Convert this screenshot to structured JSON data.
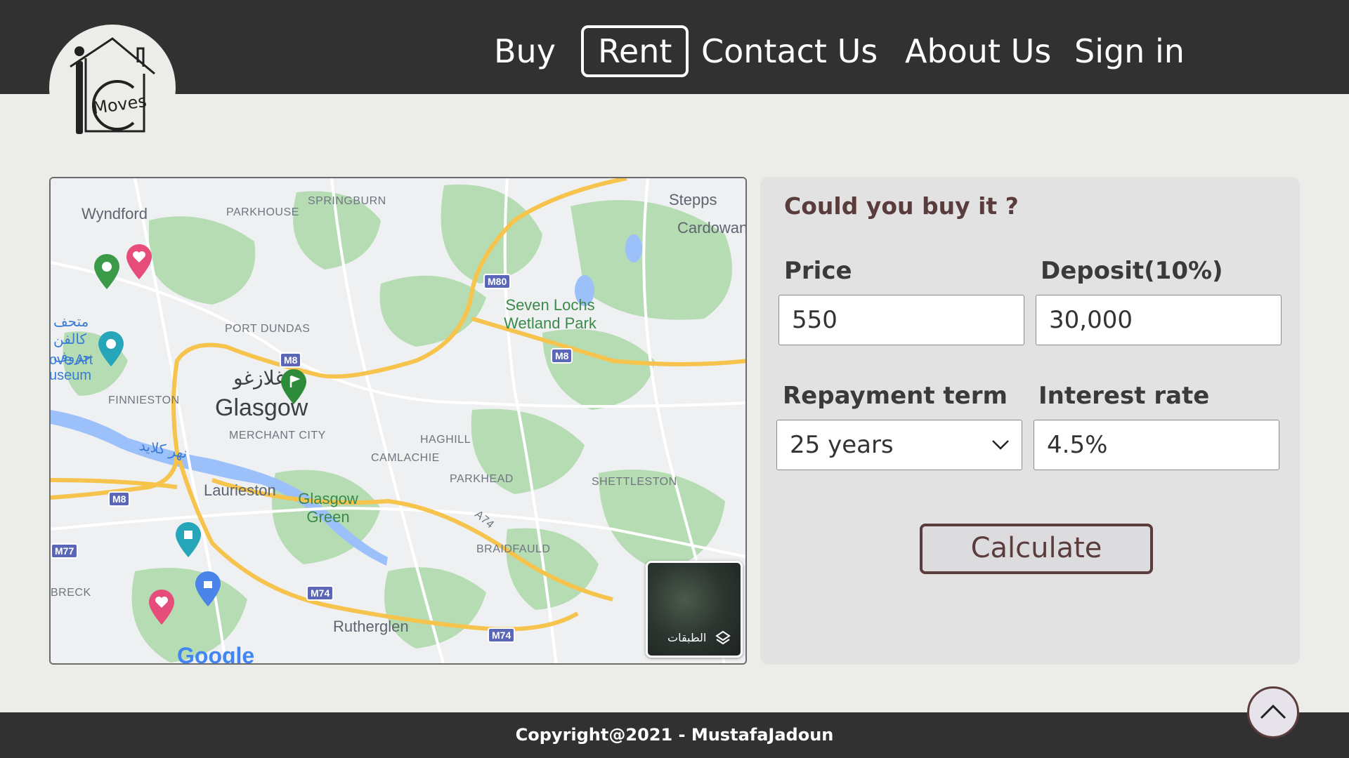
{
  "nav": {
    "items": [
      {
        "label": "Buy",
        "active": false
      },
      {
        "label": "Rent",
        "active": true
      },
      {
        "label": "Contact Us",
        "active": false
      },
      {
        "label": "About Us",
        "active": false
      },
      {
        "label": "Sign in",
        "active": false
      }
    ]
  },
  "logo": {
    "text": "Moves",
    "icon": "house-logo-icon"
  },
  "map": {
    "labels": {
      "wyndford": "Wyndford",
      "parkhouse": "PARKHOUSE",
      "springburn": "SPRINGBURN",
      "stepps": "Stepps",
      "cardowan": "Cardowan",
      "seven_lochs": "Seven Lochs Wetland Park",
      "port_dundas": "PORT DUNDAS",
      "museum_ar": "متحف كالفن جروف",
      "museum_en": "ove Art useum",
      "glasgow_ar": "غلازغو",
      "glasgow": "Glasgow",
      "merchant_city": "MERCHANT CITY",
      "finnieston": "FINNIESTON",
      "haghill": "HAGHILL",
      "camlachie": "CAMLACHIE",
      "parkhead": "PARKHEAD",
      "shettleston": "SHETTLESTON",
      "river_ar": "نهر كلايد",
      "laurieston": "Laurieston",
      "glasgow_green": "Glasgow Green",
      "braidfauld": "BRAIDFAULD",
      "breck": "BRECK",
      "rutherglen": "Rutherglen",
      "a74": "A74"
    },
    "shields": {
      "m80": "M80",
      "m8_a": "M8",
      "m8_b": "M8",
      "m8_c": "M8",
      "m77": "M77",
      "m74_a": "M74",
      "m74_b": "M74"
    },
    "layers_label": "الطبقات",
    "watermark": "Google"
  },
  "calculator": {
    "title": "Could you buy it ?",
    "price_label": "Price",
    "price_value": "550",
    "deposit_label": "Deposit(10%)",
    "deposit_value": "30,000",
    "term_label": "Repayment term",
    "term_value": "25 years",
    "interest_label": "Interest rate",
    "interest_value": "4.5%",
    "button_label": "Calculate"
  },
  "footer": {
    "copyright": "Copyright@2021 - MustafaJadoun"
  },
  "colors": {
    "header_bg": "#313131",
    "accent": "#5a3c3c",
    "page_bg": "#ecece8",
    "panel_bg": "#e2e2e2"
  }
}
